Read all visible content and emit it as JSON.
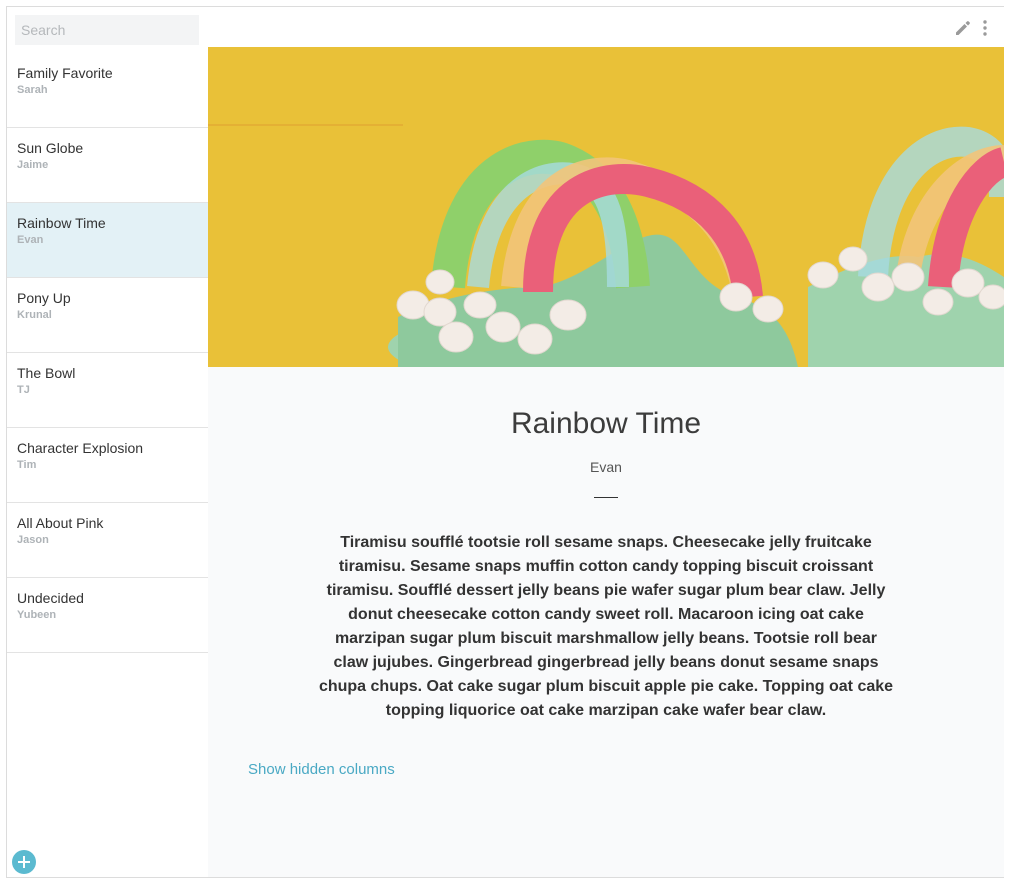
{
  "search": {
    "placeholder": "Search"
  },
  "sidebar": {
    "items": [
      {
        "title": "Family Favorite",
        "author": "Sarah"
      },
      {
        "title": "Sun Globe",
        "author": "Jaime"
      },
      {
        "title": "Rainbow Time",
        "author": "Evan"
      },
      {
        "title": "Pony Up",
        "author": "Krunal"
      },
      {
        "title": "The Bowl",
        "author": "TJ"
      },
      {
        "title": "Character Explosion",
        "author": "Tim"
      },
      {
        "title": "All About Pink",
        "author": "Jason"
      },
      {
        "title": "Undecided",
        "author": "Yubeen"
      }
    ],
    "selected_index": 2
  },
  "toolbar": {
    "edit_icon": "pencil-icon",
    "more_icon": "vertical-ellipsis-icon"
  },
  "detail": {
    "title": "Rainbow Time",
    "author": "Evan",
    "body": "Tiramisu soufflé tootsie roll sesame snaps. Cheesecake jelly fruitcake tiramisu. Sesame snaps muffin cotton candy topping biscuit croissant tiramisu. Soufflé dessert jelly beans pie wafer sugar plum bear claw. Jelly donut cheesecake cotton candy sweet roll. Macaroon icing oat cake marzipan sugar plum biscuit marshmallow jelly beans. Tootsie roll bear claw jujubes. Gingerbread gingerbread jelly beans donut sesame snaps chupa chups. Oat cake sugar plum biscuit apple pie cake. Topping oat cake topping liquorice oat cake marzipan cake wafer bear claw.",
    "show_hidden_label": "Show hidden columns"
  },
  "colors": {
    "accent": "#5bbad0",
    "link": "#4aa9c4",
    "selected_row": "#e3f1f6",
    "hero_background": "#ecc43a"
  }
}
